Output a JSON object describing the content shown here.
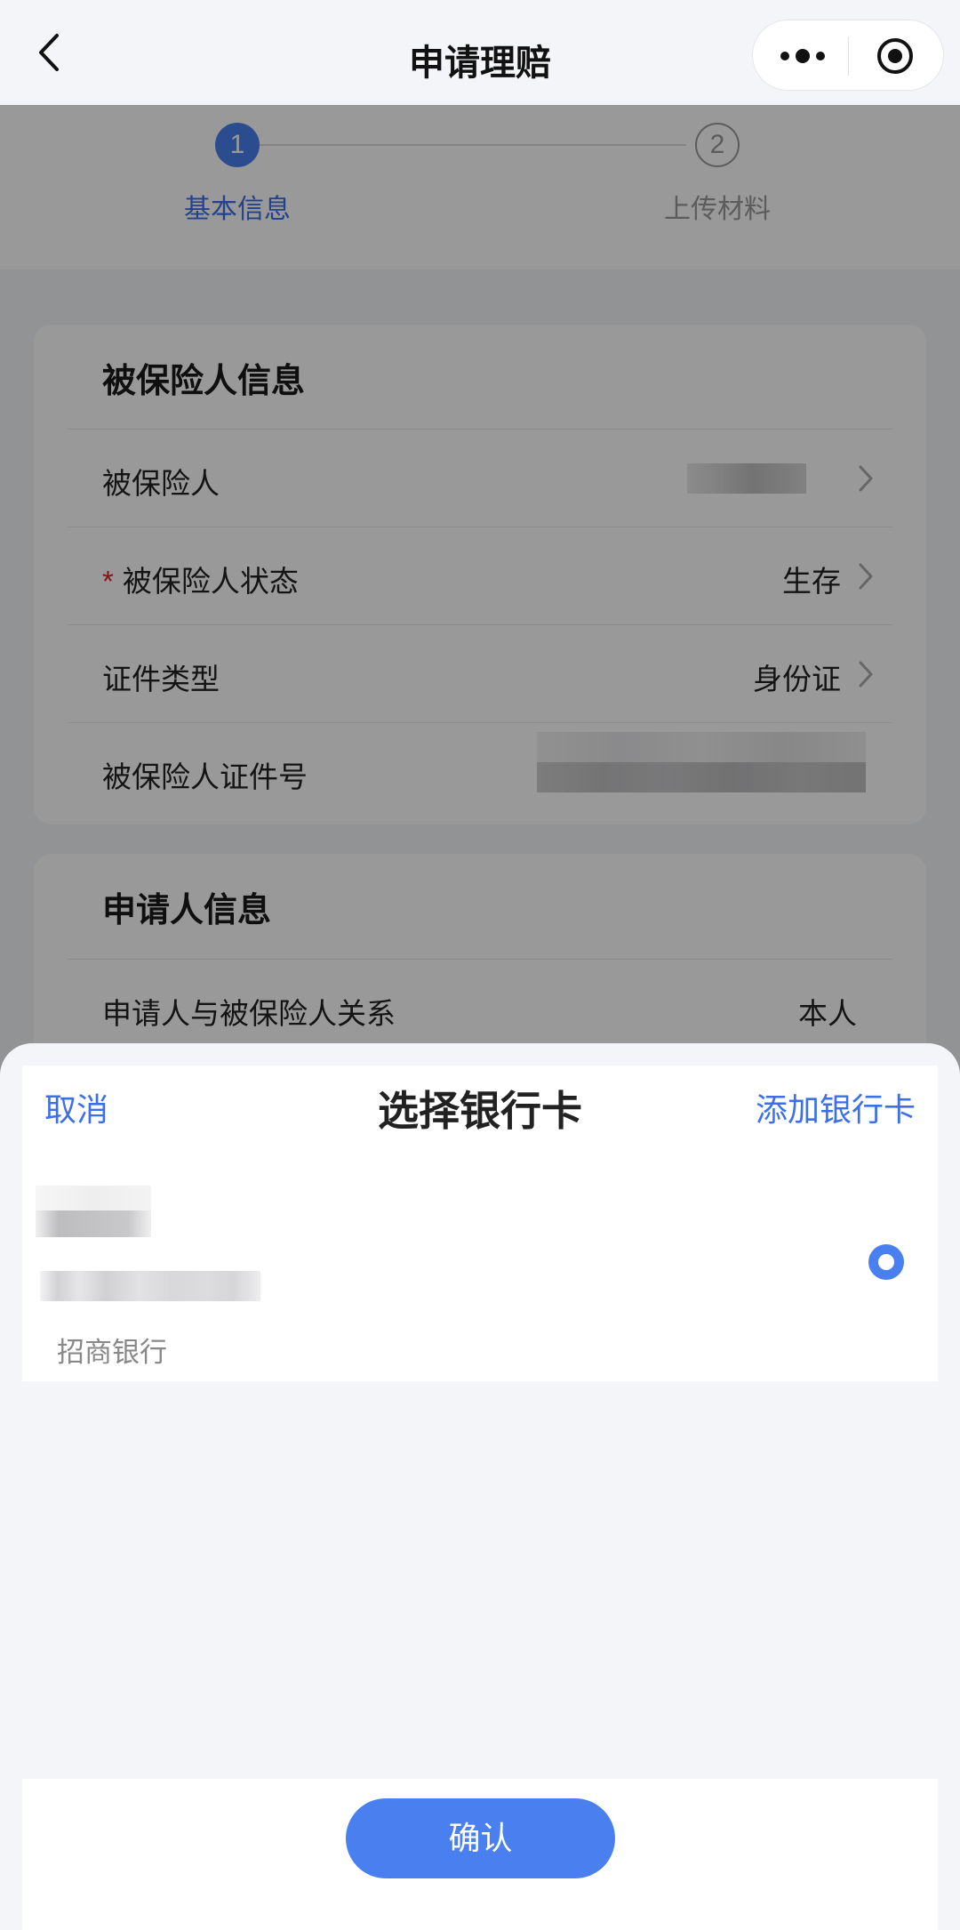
{
  "navbar": {
    "title": "申请理赔",
    "back_icon": "chevron-left-icon",
    "more_icon": "more-dots-icon",
    "close_icon": "target-close-icon"
  },
  "stepper": {
    "steps": [
      {
        "number": "1",
        "label": "基本信息",
        "state": "active"
      },
      {
        "number": "2",
        "label": "上传材料",
        "state": "inactive"
      }
    ]
  },
  "insured": {
    "title": "被保险人信息",
    "rows": [
      {
        "label": "被保险人",
        "value": ""
      },
      {
        "label": "被保险人状态",
        "value": "生存",
        "required": true
      },
      {
        "label": "证件类型",
        "value": "身份证"
      },
      {
        "label": "被保险人证件号",
        "value": ""
      }
    ]
  },
  "applicant": {
    "title": "申请人信息",
    "rows": [
      {
        "label": "申请人与被保险人关系",
        "value": "本人"
      }
    ]
  },
  "sheet": {
    "cancel_label": "取消",
    "title": "选择银行卡",
    "add_label": "添加银行卡",
    "cards": [
      {
        "holder_name": "",
        "card_number": "",
        "bank_name": "招商银行",
        "selected": true
      }
    ],
    "confirm_label": "确认"
  },
  "colors": {
    "accent": "#4a7ff0",
    "link": "#3d6fe6",
    "required": "#e02020",
    "page_background": "#f4f5f9"
  }
}
